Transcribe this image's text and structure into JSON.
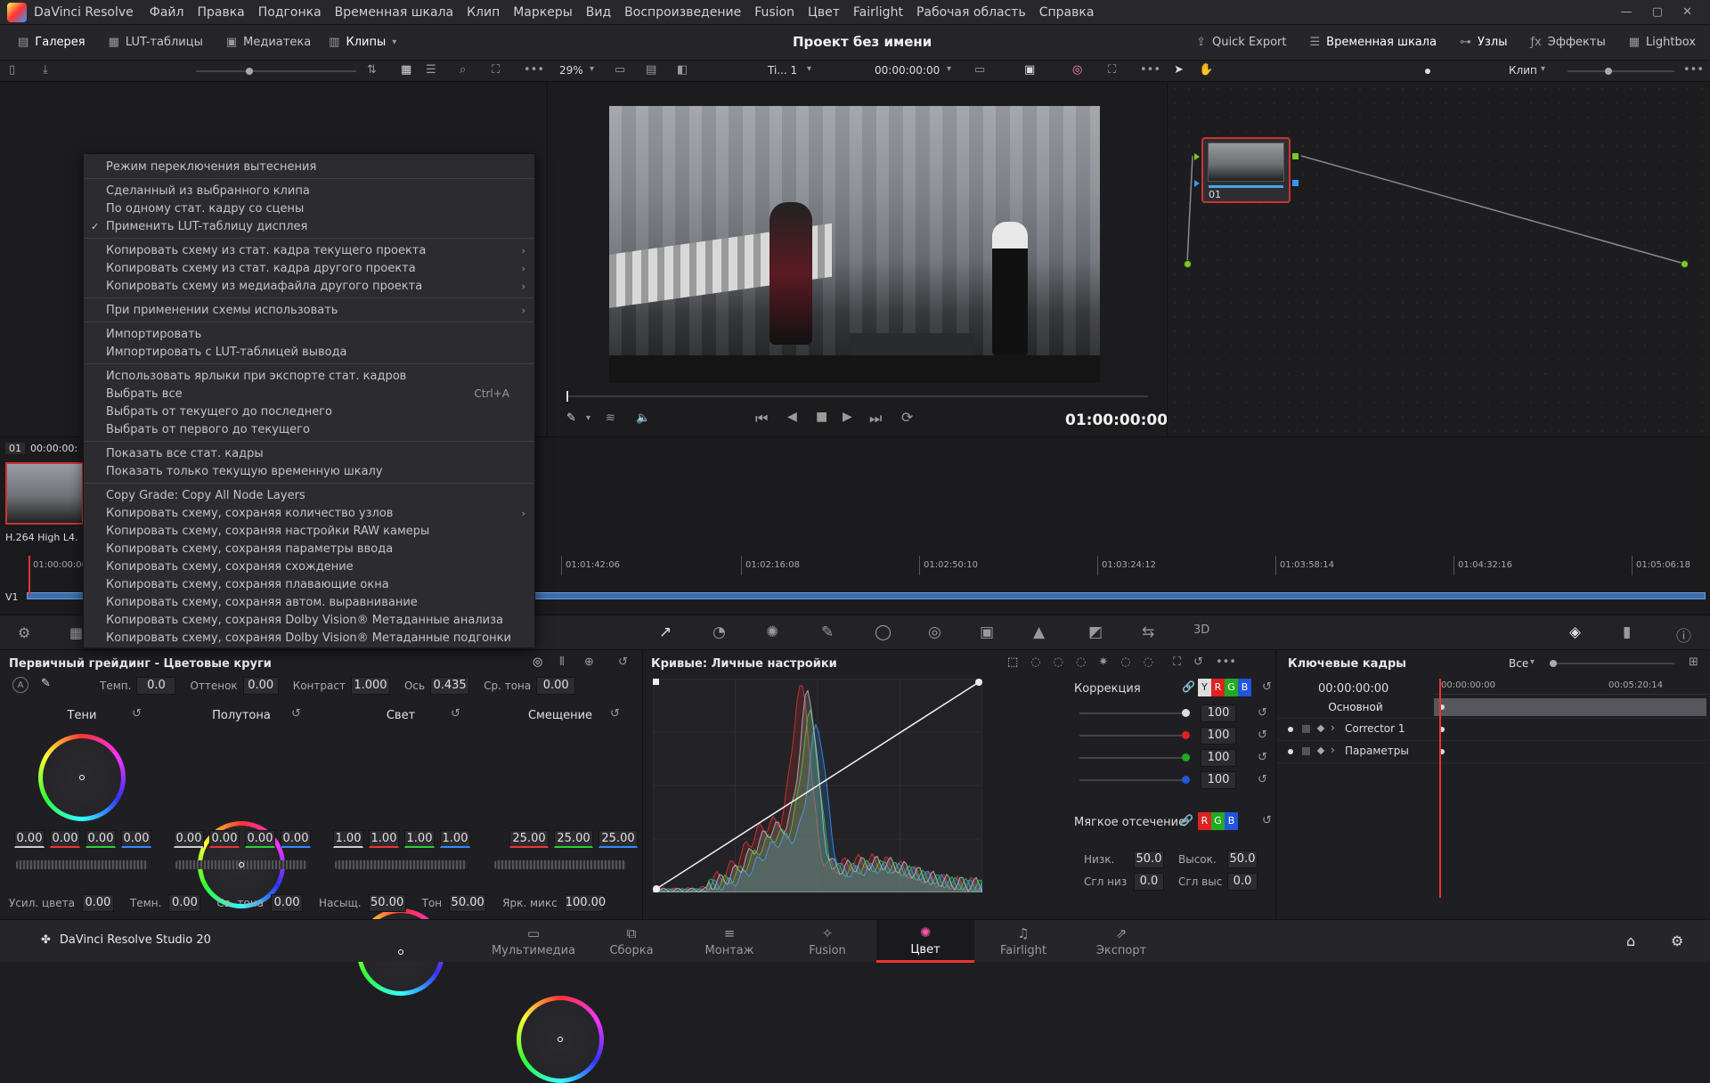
{
  "menubar": {
    "app": "DaVinci Resolve",
    "items": [
      "Файл",
      "Правка",
      "Подгонка",
      "Временная шкала",
      "Клип",
      "Маркеры",
      "Вид",
      "Воспроизведение",
      "Fusion",
      "Цвет",
      "Fairlight",
      "Рабочая область",
      "Справка"
    ]
  },
  "toolbar": {
    "gallery": "Галерея",
    "luts": "LUT-таблицы",
    "media": "Медиатека",
    "clips": "Клипы",
    "project_title": "Проект без имени",
    "quick_export": "Quick Export",
    "timeline": "Временная шкала",
    "nodes": "Узлы",
    "effects": "Эффекты",
    "lightbox": "Lightbox"
  },
  "viewer": {
    "zoom": "29%",
    "timeline_name": "Ti... 1",
    "timecode_top": "00:00:00:00",
    "timecode": "01:00:00:00"
  },
  "nodes": {
    "mode": "Клип",
    "node_label": "01"
  },
  "context_menu": {
    "items": [
      {
        "label": "Режим переключения вытеснения"
      },
      {
        "sep": true
      },
      {
        "label": "Сделанный из выбранного клипа"
      },
      {
        "label": "По одному стат. кадру со сцены"
      },
      {
        "label": "Применить LUT-таблицу дисплея",
        "check": "✓"
      },
      {
        "sep": true
      },
      {
        "label": "Копировать схему из стат. кадра текущего проекта",
        "arrow": "›"
      },
      {
        "label": "Копировать схему из стат. кадра другого проекта",
        "arrow": "›"
      },
      {
        "label": "Копировать схему из медиафайла другого проекта",
        "arrow": "›"
      },
      {
        "sep": true
      },
      {
        "label": "При применении схемы использовать",
        "arrow": "›"
      },
      {
        "sep": true
      },
      {
        "label": "Импортировать"
      },
      {
        "label": "Импортировать с LUT-таблицей вывода"
      },
      {
        "sep": true
      },
      {
        "label": "Использовать ярлыки при экспорте стат. кадров"
      },
      {
        "label": "Выбрать все",
        "shortcut": "Ctrl+A"
      },
      {
        "label": "Выбрать от текущего до последнего"
      },
      {
        "label": "Выбрать от первого до текущего"
      },
      {
        "sep": true
      },
      {
        "label": "Показать все стат. кадры"
      },
      {
        "label": "Показать только текущую временную шкалу"
      },
      {
        "sep": true
      },
      {
        "label": "Copy Grade: Copy All Node Layers"
      },
      {
        "label": "Копировать схему, сохраняя количество узлов",
        "arrow": "›"
      },
      {
        "label": "Копировать схему, сохраняя настройки RAW камеры"
      },
      {
        "label": "Копировать схему, сохраняя параметры ввода"
      },
      {
        "label": "Копировать схему, сохраняя схождение"
      },
      {
        "label": "Копировать схему, сохраняя плавающие окна"
      },
      {
        "label": "Копировать схему, сохраняя автом. выравнивание"
      },
      {
        "label": "Копировать схему, сохраняя Dolby Vision® Метаданные анализа"
      },
      {
        "label": "Копировать схему, сохраняя Dolby Vision® Метаданные подгонки"
      }
    ]
  },
  "clips": {
    "clip_number": "01",
    "clip_tc": "00:00:00:",
    "clip_codec": "H.264 High L4.",
    "track": "V1",
    "ruler": [
      "01:00:00:00",
      "01:01:42:06",
      "01:02:16:08",
      "01:02:50:10",
      "01:03:24:12",
      "01:03:58:14",
      "01:04:32:16",
      "01:05:06:18"
    ]
  },
  "wheels": {
    "title": "Первичный грейдинг - Цветовые круги",
    "params": [
      {
        "label": "Темп.",
        "value": "0.0"
      },
      {
        "label": "Оттенок",
        "value": "0.00"
      },
      {
        "label": "Контраст",
        "value": "1.000"
      },
      {
        "label": "Ось",
        "value": "0.435"
      },
      {
        "label": "Ср. тона",
        "value": "0.00"
      }
    ],
    "wheels": [
      {
        "name": "Тени",
        "values": [
          "0.00",
          "0.00",
          "0.00",
          "0.00"
        ]
      },
      {
        "name": "Полутона",
        "values": [
          "0.00",
          "0.00",
          "0.00",
          "0.00"
        ]
      },
      {
        "name": "Свет",
        "values": [
          "1.00",
          "1.00",
          "1.00",
          "1.00"
        ]
      },
      {
        "name": "Смещение",
        "values": [
          "25.00",
          "25.00",
          "25.00"
        ]
      }
    ],
    "bottom": [
      {
        "label": "Усил. цвета",
        "value": "0.00"
      },
      {
        "label": "Темн.",
        "value": "0.00"
      },
      {
        "label": "Св. тона",
        "value": "0.00"
      },
      {
        "label": "Насыщ.",
        "value": "50.00"
      },
      {
        "label": "Тон",
        "value": "50.00"
      },
      {
        "label": "Ярк. микс",
        "value": "100.00"
      }
    ]
  },
  "curves": {
    "title": "Кривые: Личные настройки",
    "correction": "Коррекция",
    "channel_values": [
      "100",
      "100",
      "100",
      "100"
    ],
    "channel_buttons": [
      "Y",
      "R",
      "G",
      "B"
    ],
    "soft_clip": "Мягкое отсечение",
    "soft_buttons": [
      "R",
      "G",
      "B"
    ],
    "low_label": "Низк.",
    "low_value": "50.0",
    "high_label": "Высок.",
    "high_value": "50.0",
    "ls_label": "Сгл низ",
    "ls_value": "0.0",
    "hs_label": "Сгл выс",
    "hs_value": "0.0"
  },
  "keyframes": {
    "title": "Ключевые кадры",
    "filter": "Все",
    "tc_left": "00:00:00:00",
    "tc_ruler_start": "00:00:00:00",
    "tc_ruler_end": "00:05:20:14",
    "rows": [
      "Основной",
      "Corrector 1",
      "Параметры"
    ]
  },
  "pagebar": {
    "brand": "DaVinci Resolve Studio 20",
    "pages": [
      "Мультимедиа",
      "Сборка",
      "Монтаж",
      "Fusion",
      "Цвет",
      "Fairlight",
      "Экспорт"
    ],
    "active": "Цвет"
  }
}
